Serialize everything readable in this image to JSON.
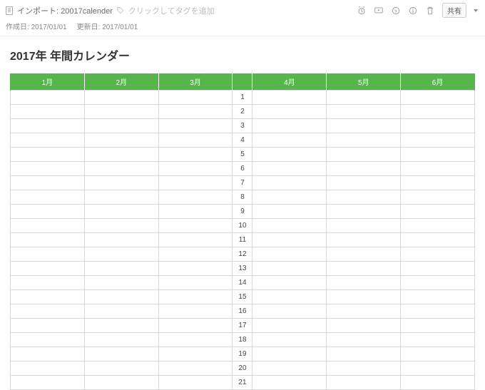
{
  "header": {
    "import_prefix": "インポート:",
    "note_name": "20017calender",
    "tag_placeholder": "クリックしてタグを追加",
    "created_label": "作成日:",
    "created_value": "2017/01/01",
    "updated_label": "更新日:",
    "updated_value": "2017/01/01",
    "share_label": "共有"
  },
  "document": {
    "title": "2017年 年間カレンダー"
  },
  "calendar": {
    "months": [
      "1月",
      "2月",
      "3月",
      "4月",
      "5月",
      "6月"
    ],
    "rows": [
      {
        "day": 1,
        "left": [
          "pink",
          "",
          ""
        ],
        "right": [
          "green",
          "",
          ""
        ]
      },
      {
        "day": 2,
        "left": [
          "",
          "",
          ""
        ],
        "right": [
          "green",
          "",
          ""
        ]
      },
      {
        "day": 3,
        "left": [
          "",
          "",
          ""
        ],
        "right": [
          "",
          "pink",
          "green"
        ]
      },
      {
        "day": 4,
        "left": [
          "",
          "green",
          ""
        ],
        "right": [
          "",
          "pink",
          "green"
        ]
      },
      {
        "day": 5,
        "left": [
          "",
          "green",
          ""
        ],
        "right": [
          "",
          "pink",
          ""
        ]
      },
      {
        "day": 6,
        "left": [
          "",
          "",
          ""
        ],
        "right": [
          "",
          "green",
          ""
        ]
      },
      {
        "day": 7,
        "left": [
          "green",
          "",
          ""
        ],
        "right": [
          "",
          "green",
          ""
        ]
      },
      {
        "day": 8,
        "left": [
          "green",
          "",
          ""
        ],
        "right": [
          "green",
          "",
          ""
        ]
      },
      {
        "day": 9,
        "left": [
          "pink",
          "",
          ""
        ],
        "right": [
          "green",
          "",
          ""
        ]
      },
      {
        "day": 10,
        "left": [
          "",
          "",
          ""
        ],
        "right": [
          "",
          "",
          ""
        ]
      },
      {
        "day": 11,
        "left": [
          "",
          "green",
          "green"
        ],
        "right": [
          "",
          "",
          ""
        ]
      },
      {
        "day": 12,
        "left": [
          "",
          "green",
          "green"
        ],
        "right": [
          "",
          "",
          ""
        ]
      },
      {
        "day": 13,
        "left": [
          "",
          "",
          ""
        ],
        "right": [
          "",
          "green",
          ""
        ]
      },
      {
        "day": 14,
        "left": [
          "green",
          "",
          ""
        ],
        "right": [
          "",
          "green",
          ""
        ]
      },
      {
        "day": 15,
        "left": [
          "green",
          "",
          ""
        ],
        "right": [
          "green",
          "",
          ""
        ]
      },
      {
        "day": 16,
        "left": [
          "",
          "",
          ""
        ],
        "right": [
          "green",
          "",
          ""
        ]
      },
      {
        "day": 17,
        "left": [
          "",
          "",
          ""
        ],
        "right": [
          "",
          "",
          ""
        ]
      },
      {
        "day": 18,
        "left": [
          "",
          "green",
          "green"
        ],
        "right": [
          "",
          "",
          ""
        ]
      },
      {
        "day": 19,
        "left": [
          "",
          "green",
          "green"
        ],
        "right": [
          "",
          "",
          ""
        ]
      },
      {
        "day": 20,
        "left": [
          "",
          "",
          "pink"
        ],
        "right": [
          "",
          "green",
          ""
        ]
      },
      {
        "day": 21,
        "left": [
          "green",
          "",
          ""
        ],
        "right": [
          "",
          "green",
          ""
        ]
      }
    ]
  }
}
